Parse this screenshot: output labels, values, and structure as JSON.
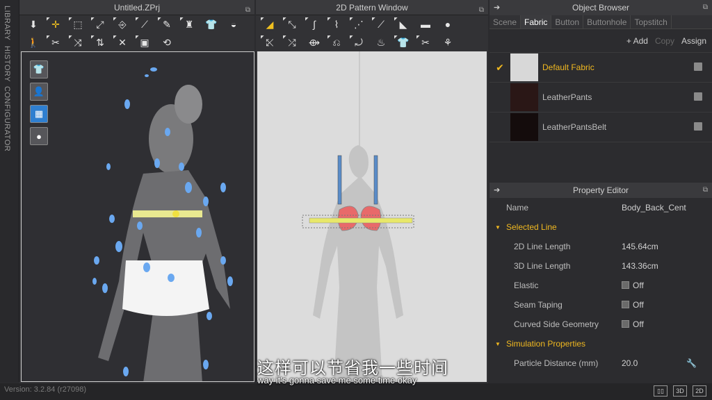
{
  "sidebar_tabs": [
    "LIBRARY",
    "HISTORY",
    "CONFIGURATOR"
  ],
  "window_3d": {
    "title": "Untitled.ZPrj"
  },
  "window_2d": {
    "title": "2D Pattern Window"
  },
  "object_browser": {
    "title": "Object Browser",
    "tabs": [
      "Scene",
      "Fabric",
      "Button",
      "Buttonhole",
      "Topstitch"
    ],
    "active_tab": "Fabric",
    "actions": {
      "add": "+ Add",
      "copy": "Copy",
      "assign": "Assign"
    },
    "fabrics": [
      {
        "name": "Default Fabric",
        "selected": true,
        "color": "#d8d8d8"
      },
      {
        "name": "LeatherPants",
        "selected": false,
        "color": "#2a1716"
      },
      {
        "name": "LeatherPantsBelt",
        "selected": false,
        "color": "#140c0c"
      }
    ]
  },
  "property_editor": {
    "title": "Property Editor",
    "name_label": "Name",
    "name_value": "Body_Back_Cent",
    "groups": [
      {
        "label": "Selected Line",
        "rows": [
          {
            "label": "2D Line Length",
            "value": "145.64cm"
          },
          {
            "label": "3D Line Length",
            "value": "143.36cm"
          },
          {
            "label": "Elastic",
            "value": "Off",
            "checkbox": true
          },
          {
            "label": "Seam Taping",
            "value": "Off",
            "checkbox": true
          },
          {
            "label": "Curved Side Geometry",
            "value": "Off",
            "checkbox": true
          }
        ]
      },
      {
        "label": "Simulation Properties",
        "rows": [
          {
            "label": "Particle Distance (mm)",
            "value": "20.0"
          }
        ]
      }
    ]
  },
  "status": {
    "version": "Version: 3.2.84   (r27098)"
  },
  "status_buttons": [
    "3D",
    "2D"
  ],
  "subtitles": {
    "chinese": "这样可以节省我一些时间",
    "english": "way it's gonna save me some time okay"
  },
  "colors": {
    "accent": "#f0b820",
    "panel": "#2c2c2f",
    "viewport2d": "#dcdcdc"
  }
}
